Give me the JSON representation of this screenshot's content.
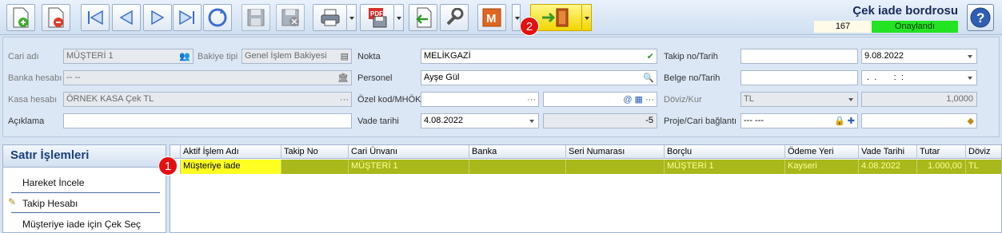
{
  "toolbar": {
    "buttons": [
      "new-document",
      "delete-document",
      "first",
      "previous",
      "next",
      "last",
      "refresh",
      "save",
      "cancel",
      "print",
      "pdf-export",
      "import",
      "tools",
      "module-m",
      "transfer"
    ],
    "accent": "#f5e61a"
  },
  "document": {
    "title": "Çek iade bordrosu",
    "number": "167",
    "status": "Onaylandı",
    "status_color": "#23e323"
  },
  "annotations": {
    "badge_1": "1",
    "badge_2": "2"
  },
  "form": {
    "cari_adi": {
      "label": "Cari adı",
      "value": "MÜŞTERİ 1"
    },
    "bakiye_tipi": {
      "label": "Bakiye tipi",
      "value": "Genel İşlem Bakiyesi"
    },
    "banka_hesabi": {
      "label": "Banka hesabı",
      "value": "-- --"
    },
    "kasa_hesabi": {
      "label": "Kasa hesabı",
      "value": "ÖRNEK KASA Çek TL"
    },
    "aciklama": {
      "label": "Açıklama",
      "value": ""
    },
    "nokta": {
      "label": "Nokta",
      "value": "MELİKGAZİ"
    },
    "personel": {
      "label": "Personel",
      "value": "Ayşe Gül"
    },
    "ozel_kod": {
      "label": "Özel kod/MHÖK",
      "value": "",
      "value2": ""
    },
    "vade_tarihi": {
      "label": "Vade tarihi",
      "value": "4.08.2022",
      "days": "-5"
    },
    "takip_no": {
      "label": "Takip no/Tarih",
      "value": "",
      "date": "9.08.2022"
    },
    "belge_no": {
      "label": "Belge no/Tarih",
      "value": "",
      "date": " .  .       :  :"
    },
    "doviz_kur": {
      "label": "Döviz/Kur",
      "currency": "TL",
      "rate": "1,0000"
    },
    "proje": {
      "label": "Proje/Cari bağlantı",
      "value": "--- ---",
      "value2": ""
    }
  },
  "side_panel": {
    "title": "Satır İşlemleri",
    "items": [
      "Hareket İncele",
      "Takip Hesabı",
      "Müşteriye iade için Çek Seç"
    ]
  },
  "grid": {
    "columns": [
      "Aktif İşlem Adı",
      "Takip No",
      "Cari Ünvanı",
      "Banka",
      "Seri Numarası",
      "Borçlu",
      "Ödeme Yeri",
      "Vade Tarihi",
      "Tutar",
      "Döviz"
    ],
    "rows": [
      [
        "Müşteriye iade",
        "",
        "MÜŞTERİ 1",
        "",
        "",
        "MÜŞTERİ 1",
        "Kayseri",
        "4.08.2022",
        "1.000,00",
        "TL"
      ]
    ]
  }
}
